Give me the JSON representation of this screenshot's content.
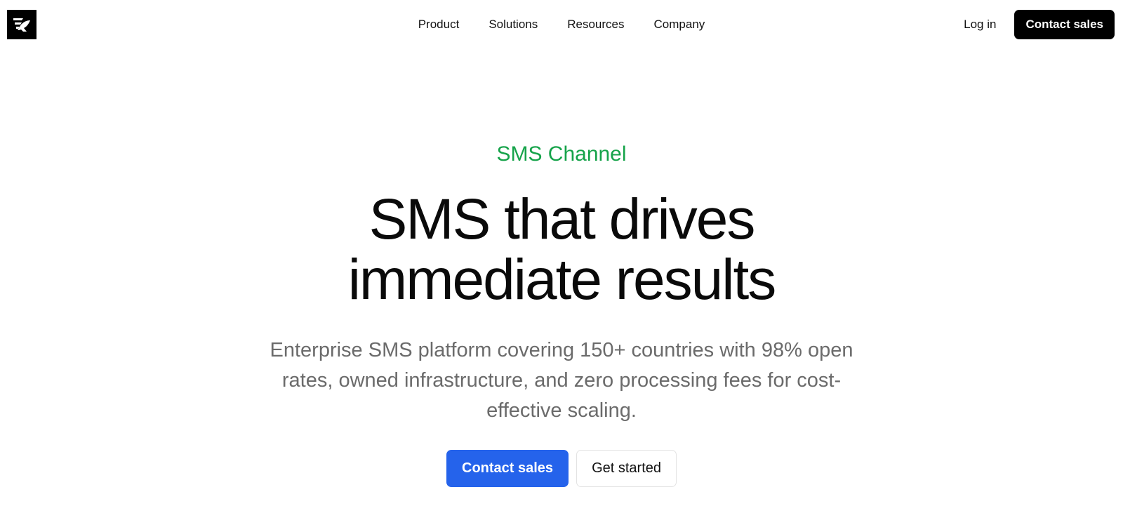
{
  "header": {
    "logo_icon": "brand-bird-logo",
    "nav": [
      {
        "label": "Product"
      },
      {
        "label": "Solutions"
      },
      {
        "label": "Resources"
      },
      {
        "label": "Company"
      }
    ],
    "login_label": "Log in",
    "contact_label": "Contact sales"
  },
  "hero": {
    "eyebrow": "SMS Channel",
    "headline_line1": "SMS that drives",
    "headline_line2": "immediate results",
    "subtext": "Enterprise SMS platform covering 150+ countries with 98% open rates, owned infrastructure, and zero processing fees for cost-effective scaling.",
    "primary_cta": "Contact sales",
    "secondary_cta": "Get started"
  },
  "colors": {
    "accent_green": "#16a34a",
    "primary_blue": "#2563eb",
    "dark": "#000000",
    "muted_text": "#6b6b6b"
  }
}
